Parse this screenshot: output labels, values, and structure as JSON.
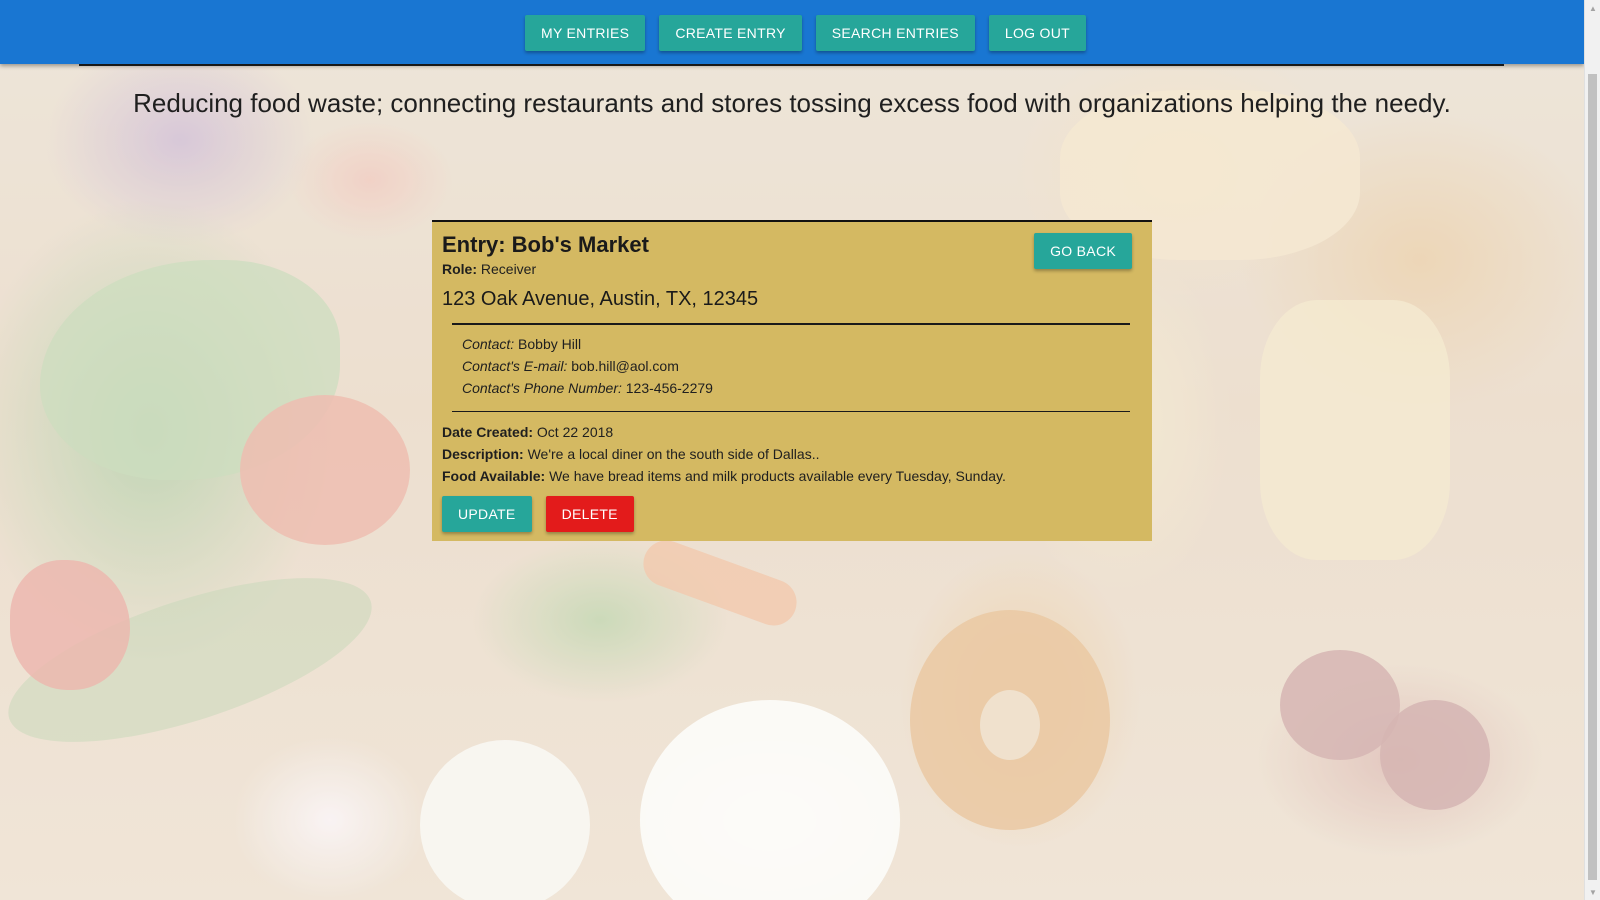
{
  "nav": {
    "items": [
      {
        "label": "MY ENTRIES"
      },
      {
        "label": "CREATE ENTRY"
      },
      {
        "label": "SEARCH ENTRIES"
      },
      {
        "label": "LOG OUT"
      }
    ]
  },
  "tagline": "Reducing food waste; connecting restaurants and stores tossing excess food with organizations helping the needy.",
  "entry": {
    "title": "Entry: Bob's Market",
    "go_back_label": "GO BACK",
    "role_label": "Role:",
    "role_value": "Receiver",
    "address": "123 Oak Avenue, Austin, TX, 12345",
    "contact_label": "Contact:",
    "contact_value": "Bobby Hill",
    "email_label": "Contact's E-mail:",
    "email_value": "bob.hill@aol.com",
    "phone_label": "Contact's Phone Number:",
    "phone_value": "123-456-2279",
    "date_label": "Date Created:",
    "date_value": "Oct 22 2018",
    "description_label": "Description:",
    "description_value": "We're a local diner on the south side of Dallas..",
    "food_label": "Food Available:",
    "food_value": "We have bread items and milk products available every Tuesday, Sunday.",
    "update_label": "UPDATE",
    "delete_label": "DELETE"
  },
  "icons": {
    "scroll_up": "scroll-up-arrow-icon",
    "scroll_down": "scroll-down-arrow-icon"
  },
  "colors": {
    "appbar": "#1976d2",
    "button_teal": "#26a69a",
    "button_red": "#e31b1b",
    "card": "#d4b962"
  }
}
